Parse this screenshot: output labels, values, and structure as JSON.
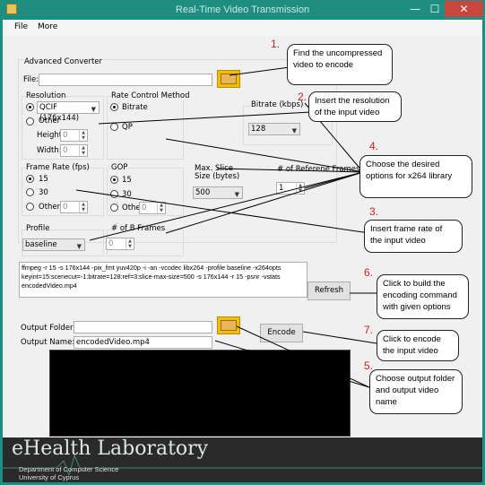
{
  "window": {
    "title": "Real-Time Video Transmission",
    "minimize": "—",
    "maximize": "☐",
    "close": "✕"
  },
  "menu": [
    "File",
    "More"
  ],
  "converter": {
    "group_label": "Advanced Converter",
    "file_label": "File:",
    "file_value": ""
  },
  "resolution": {
    "label": "Resolution",
    "option_qcif": "QCIF (176x144)",
    "option_other": "Other",
    "height_label": "Height:",
    "height_value": "0",
    "width_label": "Width:",
    "width_value": "0"
  },
  "rate_control": {
    "label": "Rate Control Method",
    "option_bitrate": "Bitrate",
    "option_qp": "QP"
  },
  "bitrate": {
    "label": "Bitrate (kbps)",
    "value": "128"
  },
  "frame_rate": {
    "label": "Frame Rate (fps)",
    "option_15": "15",
    "option_30": "30",
    "option_other": "Other",
    "other_value": "0"
  },
  "gop": {
    "label": "GOP",
    "option_15": "15",
    "option_30": "30",
    "option_other": "Other",
    "other_value": "0"
  },
  "slice": {
    "label": "Max. Slice Size (bytes)",
    "value": "500"
  },
  "ref_frames": {
    "label": "# of Referene Frames",
    "value": "1"
  },
  "profile": {
    "label": "Profile",
    "value": "baseline"
  },
  "bframes": {
    "label": "# of B Frames",
    "value": "0"
  },
  "command": "ffmpeg -r 15 -s 176x144 -pix_fmt yuv420p -i  -an -vcodec libx264 -profile baseline -x264opts keyint=15:scenecut=-1:bitrate=128:ref=3:slice-max-size=500 -s 176x144 -r 15 -psnr -vstats encodedVideo.mp4",
  "refresh_label": "Refresh",
  "output": {
    "folder_label": "Output Folder:",
    "folder_value": "",
    "name_label": "Output Name:",
    "name_value": "encodedVideo.mp4"
  },
  "encode_label": "Encode",
  "footer": {
    "logo": "eHealth Laboratory",
    "dept": "Department of Computer Science",
    "univ": "University of Cyprus"
  },
  "annotations": [
    {
      "num": "1.",
      "text": "Find the uncompressed video to encode"
    },
    {
      "num": "2.",
      "text": "Insert the resolution of the input video"
    },
    {
      "num": "3.",
      "text": "Insert frame rate of the input video"
    },
    {
      "num": "4.",
      "text": "Choose the desired options for x264 library"
    },
    {
      "num": "5.",
      "text": "Choose output folder and output video name"
    },
    {
      "num": "6.",
      "text": "Click to build the encoding command with given options"
    },
    {
      "num": "7.",
      "text": "Click to encode the input video"
    }
  ],
  "colors": {
    "titlebar": "#1e8e82",
    "close": "#c7463d",
    "annotation_number": "#d02020",
    "folder_button": "#f0c000"
  }
}
